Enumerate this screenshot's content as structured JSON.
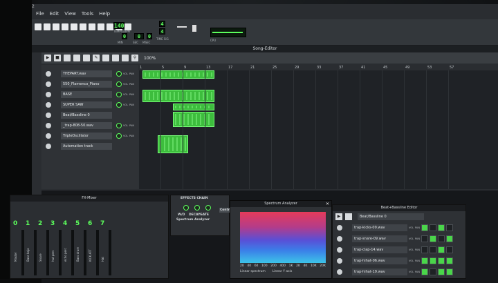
{
  "window": {
    "number": "2"
  },
  "menu": [
    "File",
    "Edit",
    "View",
    "Tools",
    "Help"
  ],
  "transport": {
    "tempo": "140",
    "tempo_label": "TEMPO/BPM",
    "time": {
      "min": "0",
      "sec": "0",
      "msec": "0"
    },
    "time_labels": {
      "min": "MIN",
      "sec": "SEC",
      "msec": "MSEC"
    },
    "timesig_top": "4",
    "timesig_bottom": "4",
    "timesig_label": "TIME SIG",
    "cpu_label": "CPU"
  },
  "song_editor": {
    "title": "Song-Editor",
    "zoom": "100%",
    "ruler": [
      "1",
      "5",
      "9",
      "13",
      "17",
      "21",
      "25",
      "29",
      "33",
      "37",
      "41",
      "45",
      "49",
      "53",
      "57"
    ],
    "tracks": [
      {
        "name": "THEPART.wav",
        "knob": true
      },
      {
        "name": "550_Flamenco_Piano",
        "knob": true
      },
      {
        "name": "BASE",
        "knob": true
      },
      {
        "name": "SUPER SAW",
        "knob": true
      },
      {
        "name": "Beat/Bassline 0",
        "knob": false
      },
      {
        "name": "_trap-808-50.wav",
        "knob": true
      },
      {
        "name": "TripleOscillator",
        "knob": true
      },
      {
        "name": "Automation track",
        "knob": false
      }
    ],
    "vol_label": "VOL",
    "pan_label": "PAN"
  },
  "fx_mixer": {
    "title": "FX-Mixer",
    "channels": [
      {
        "num": "0",
        "name": "Master"
      },
      {
        "num": "1",
        "name": "Base bajo"
      },
      {
        "num": "2",
        "name": "Snare"
      },
      {
        "num": "3",
        "name": "hat perc"
      },
      {
        "num": "4",
        "name": "echo perc"
      },
      {
        "num": "5",
        "name": "Bass drum"
      },
      {
        "num": "6",
        "name": "KICK ATT"
      },
      {
        "num": "7",
        "name": "Hat"
      }
    ]
  },
  "effects_chain": {
    "title": "EFFECTS CHAIN",
    "knobs": [
      "W/D",
      "DECAY",
      "GATE"
    ],
    "effect": "Spectrum Analyzer",
    "controls_label": "Controls"
  },
  "spectrum": {
    "title": "Spectrum Analyzer",
    "freq_ticks": [
      "20",
      "40",
      "60",
      "100",
      "200",
      "400",
      "1K",
      "2K",
      "4K",
      "10K",
      "20K"
    ],
    "options": [
      "Linear spectrum",
      "Linear Y axis"
    ]
  },
  "beat_editor": {
    "title": "Beat+Bassline Editor",
    "pattern": "Beat/Bassline 0",
    "rows": [
      {
        "name": "trap-kicks-09.wav",
        "steps": [
          1,
          0,
          1,
          0
        ]
      },
      {
        "name": "trap-snare-09.wav",
        "steps": [
          0,
          1,
          0,
          1
        ]
      },
      {
        "name": "trap-clap-14.wav",
        "steps": [
          0,
          0,
          1,
          0
        ]
      },
      {
        "name": "trap-hihat-06.wav",
        "steps": [
          1,
          1,
          1,
          1
        ]
      },
      {
        "name": "trap-hihat-19.wav",
        "steps": [
          1,
          0,
          1,
          1
        ]
      }
    ]
  },
  "colors": {
    "lcd_green": "#5cff5c",
    "pattern_green": "#3dbd3d",
    "panel": "#2e3135"
  }
}
